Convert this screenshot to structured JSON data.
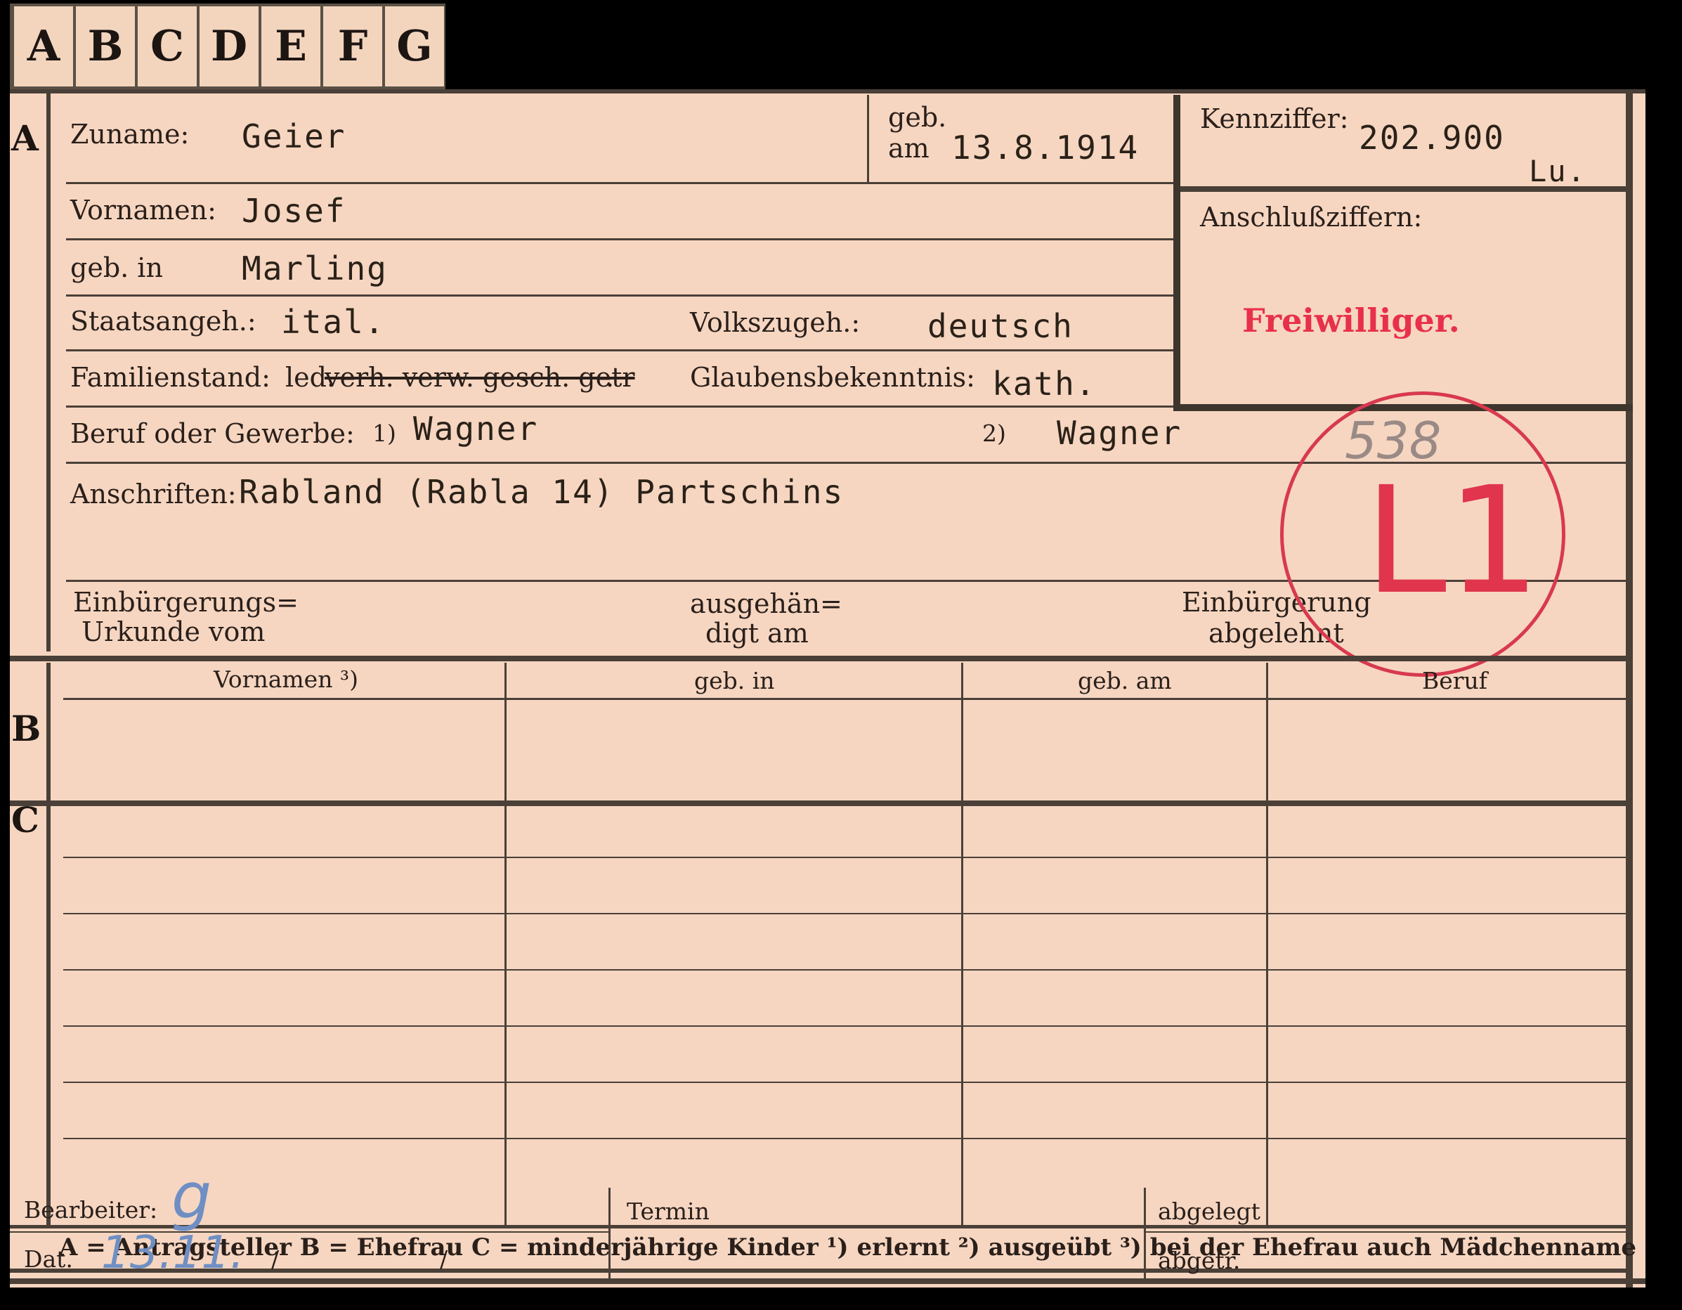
{
  "tabs": [
    "A",
    "B",
    "C",
    "D",
    "E",
    "F",
    "G"
  ],
  "sections": {
    "a": "A",
    "b": "B",
    "c": "C"
  },
  "section_a": {
    "zuname_label": "Zuname:",
    "zuname_value": "Geier",
    "geb_label_1": "geb.",
    "geb_label_2": "am",
    "geb_value": "13.8.1914",
    "kennziffer_label": "Kennziffer:",
    "kennziffer_value": "202.900",
    "kennziffer_suffix": "Lu.",
    "anschluss_label": "Anschlußziffern:",
    "freiwilliger_stamp": "Freiwilliger.",
    "vornamen_label": "Vornamen:",
    "vornamen_value": "Josef",
    "gebin_label": "geb. in",
    "gebin_value": "Marling",
    "staats_label": "Staatsangeh.:",
    "staats_value": "ital.",
    "volks_label": "Volkszugeh.:",
    "volks_value": "deutsch",
    "familien_label": "Familienstand:",
    "familien_led": "led.",
    "familien_struck": "verh. verw. gesch. getr",
    "familien_end": ".",
    "glauben_label": "Glaubensbekenntnis:",
    "glauben_value": "kath.",
    "beruf_label": "Beruf oder Gewerbe:",
    "beruf_mark1": "1)",
    "beruf_value1": "Wagner",
    "beruf_mark2": "2)",
    "beruf_value2": "Wagner",
    "anschrift_label": "Anschriften:",
    "anschrift_value": "Rabland (Rabla 14) Partschins",
    "einb_label_1": "Einbürgerungs=",
    "einb_label_2": "Urkunde vom",
    "ausgeh_label_1": "ausgehän=",
    "ausgeh_label_2": "digt am",
    "abgelehnt_label_1": "Einbürgerung",
    "abgelehnt_label_2": "abgelehnt",
    "stamp_number": "538",
    "stamp_code": "L1"
  },
  "table_headers": [
    "Vornamen ³)",
    "geb. in",
    "geb. am",
    "Beruf"
  ],
  "legend": "A = Antragsteller   B = Ehefrau   C = minderjährige Kinder   ¹) erlernt   ²) ausgeübt   ³) bei der Ehefrau auch Mädchenname",
  "footer": {
    "bearbeiter_label": "Bearbeiter:",
    "bearbeiter_hand": "g",
    "dat_label": "Dat.",
    "dat_hand": "13.11.",
    "dat_slash1": "/",
    "dat_slash2": "/",
    "termin_label": "Termin",
    "abgelegt_label": "abgelegt",
    "abgetr_label": "abgetr."
  },
  "colors": {
    "card": "#f6d6c1",
    "ink": "#2a1f1a",
    "stamp_red": "#d8394e",
    "pencil_blue": "#6f8fc4"
  }
}
